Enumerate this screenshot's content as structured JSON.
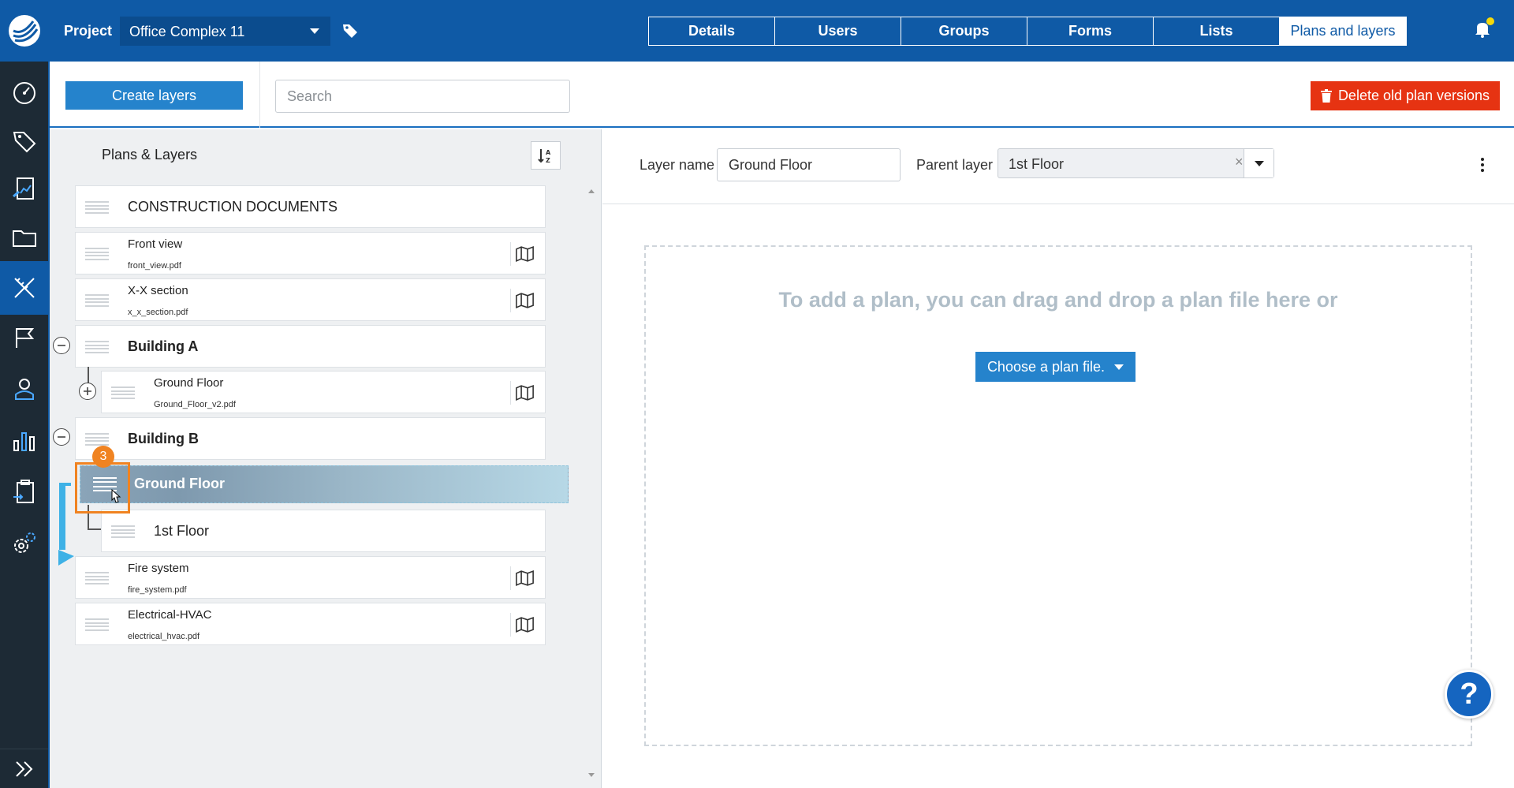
{
  "header": {
    "project_label": "Project",
    "project_value": "Office Complex 11",
    "tabs": [
      {
        "label": "Details"
      },
      {
        "label": "Users"
      },
      {
        "label": "Groups"
      },
      {
        "label": "Forms"
      },
      {
        "label": "Lists"
      },
      {
        "label": "Plans and layers",
        "active": true
      }
    ]
  },
  "toolbar": {
    "create_label": "Create layers",
    "search_placeholder": "Search",
    "delete_label": "Delete old plan versions"
  },
  "left_panel": {
    "title": "Plans & Layers",
    "items": [
      {
        "name": "CONSTRUCTION DOCUMENTS"
      },
      {
        "name": "Front view",
        "file": "front_view.pdf"
      },
      {
        "name": "X-X section",
        "file": "x_x_section.pdf"
      },
      {
        "name": "Building A"
      },
      {
        "name": "Ground Floor",
        "file": "Ground_Floor_v2.pdf"
      },
      {
        "name": "Building B"
      },
      {
        "name": "1st Floor"
      },
      {
        "name": "Fire system",
        "file": "fire_system.pdf"
      },
      {
        "name": "Electrical-HVAC",
        "file": "electrical_hvac.pdf"
      }
    ],
    "drag_ghost_label": "Ground Floor",
    "step_badge": "3"
  },
  "right_panel": {
    "layer_name_label": "Layer name",
    "layer_name_value": "Ground Floor",
    "parent_layer_label": "Parent layer",
    "parent_layer_value": "1st Floor",
    "clear_symbol": "×",
    "drop_message": "To add a plan, you can drag and drop a plan file here or",
    "choose_label": "Choose a plan file."
  },
  "help_symbol": "?",
  "colors": {
    "primary": "#0f5aa6",
    "sidebar": "#1d2a35",
    "button_blue": "#2583cc",
    "danger": "#e63312",
    "highlight": "#f08321"
  }
}
